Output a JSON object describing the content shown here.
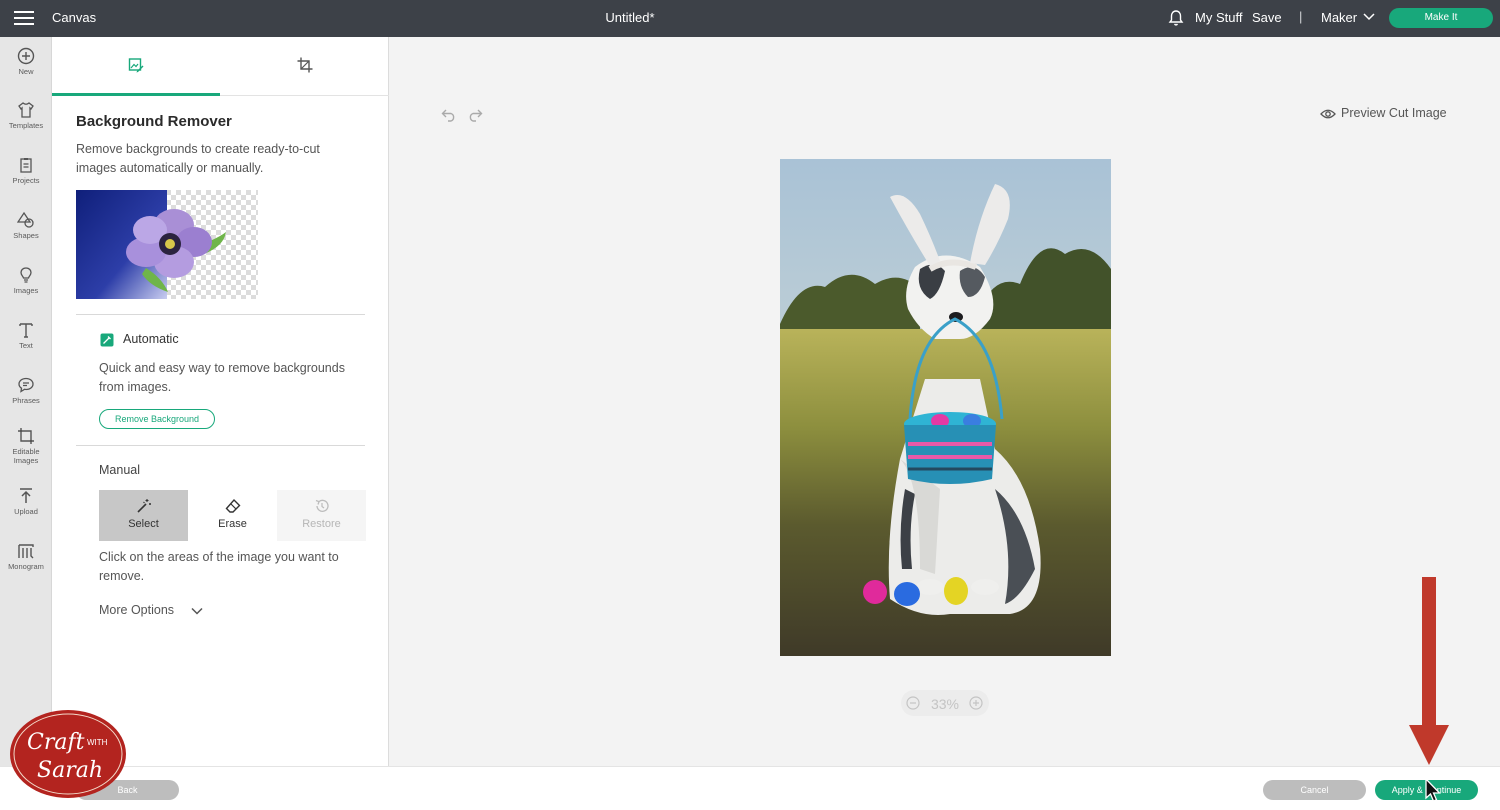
{
  "topbar": {
    "app_title": "Canvas",
    "doc_title": "Untitled*",
    "my_stuff": "My Stuff",
    "save": "Save",
    "separator": "|",
    "machine": "Maker",
    "make_it": "Make It"
  },
  "rail": {
    "items": [
      {
        "label": "New",
        "icon": "plus-circle-icon"
      },
      {
        "label": "Templates",
        "icon": "shirt-icon"
      },
      {
        "label": "Projects",
        "icon": "projects-icon"
      },
      {
        "label": "Shapes",
        "icon": "shapes-icon"
      },
      {
        "label": "Images",
        "icon": "lightbulb-icon"
      },
      {
        "label": "Text",
        "icon": "text-icon"
      },
      {
        "label": "Phrases",
        "icon": "speech-bubble-icon"
      },
      {
        "label": "Editable Images",
        "icon": "crop-edit-icon"
      },
      {
        "label": "Upload",
        "icon": "upload-icon"
      },
      {
        "label": "Monogram",
        "icon": "monogram-icon"
      }
    ]
  },
  "panel": {
    "tabs": [
      {
        "name": "background-remover",
        "icon": "image-edit-icon",
        "active": true
      },
      {
        "name": "crop",
        "icon": "crop-icon",
        "active": false
      }
    ],
    "title": "Background Remover",
    "description": "Remove backgrounds to create ready-to-cut images automatically or manually.",
    "automatic": {
      "title": "Automatic",
      "description": "Quick and easy way to remove backgrounds from images.",
      "button": "Remove Background"
    },
    "manual": {
      "title": "Manual",
      "modes": [
        {
          "label": "Select",
          "icon": "magic-wand-icon",
          "state": "active"
        },
        {
          "label": "Erase",
          "icon": "eraser-icon",
          "state": "normal"
        },
        {
          "label": "Restore",
          "icon": "restore-icon",
          "state": "disabled"
        }
      ],
      "description": "Click on the areas of the image you want to remove.",
      "more_options": "More Options"
    }
  },
  "canvas": {
    "preview_label": "Preview Cut Image",
    "zoom": "33%"
  },
  "footer": {
    "back": "Back",
    "cancel": "Cancel",
    "apply": "Apply & Continue"
  },
  "watermark": {
    "line1": "Craft",
    "line2": "WITH",
    "line3": "Sarah"
  },
  "colors": {
    "accent": "#18a87b",
    "topbar": "#3d4148",
    "annotation_arrow": "#c0392b"
  }
}
